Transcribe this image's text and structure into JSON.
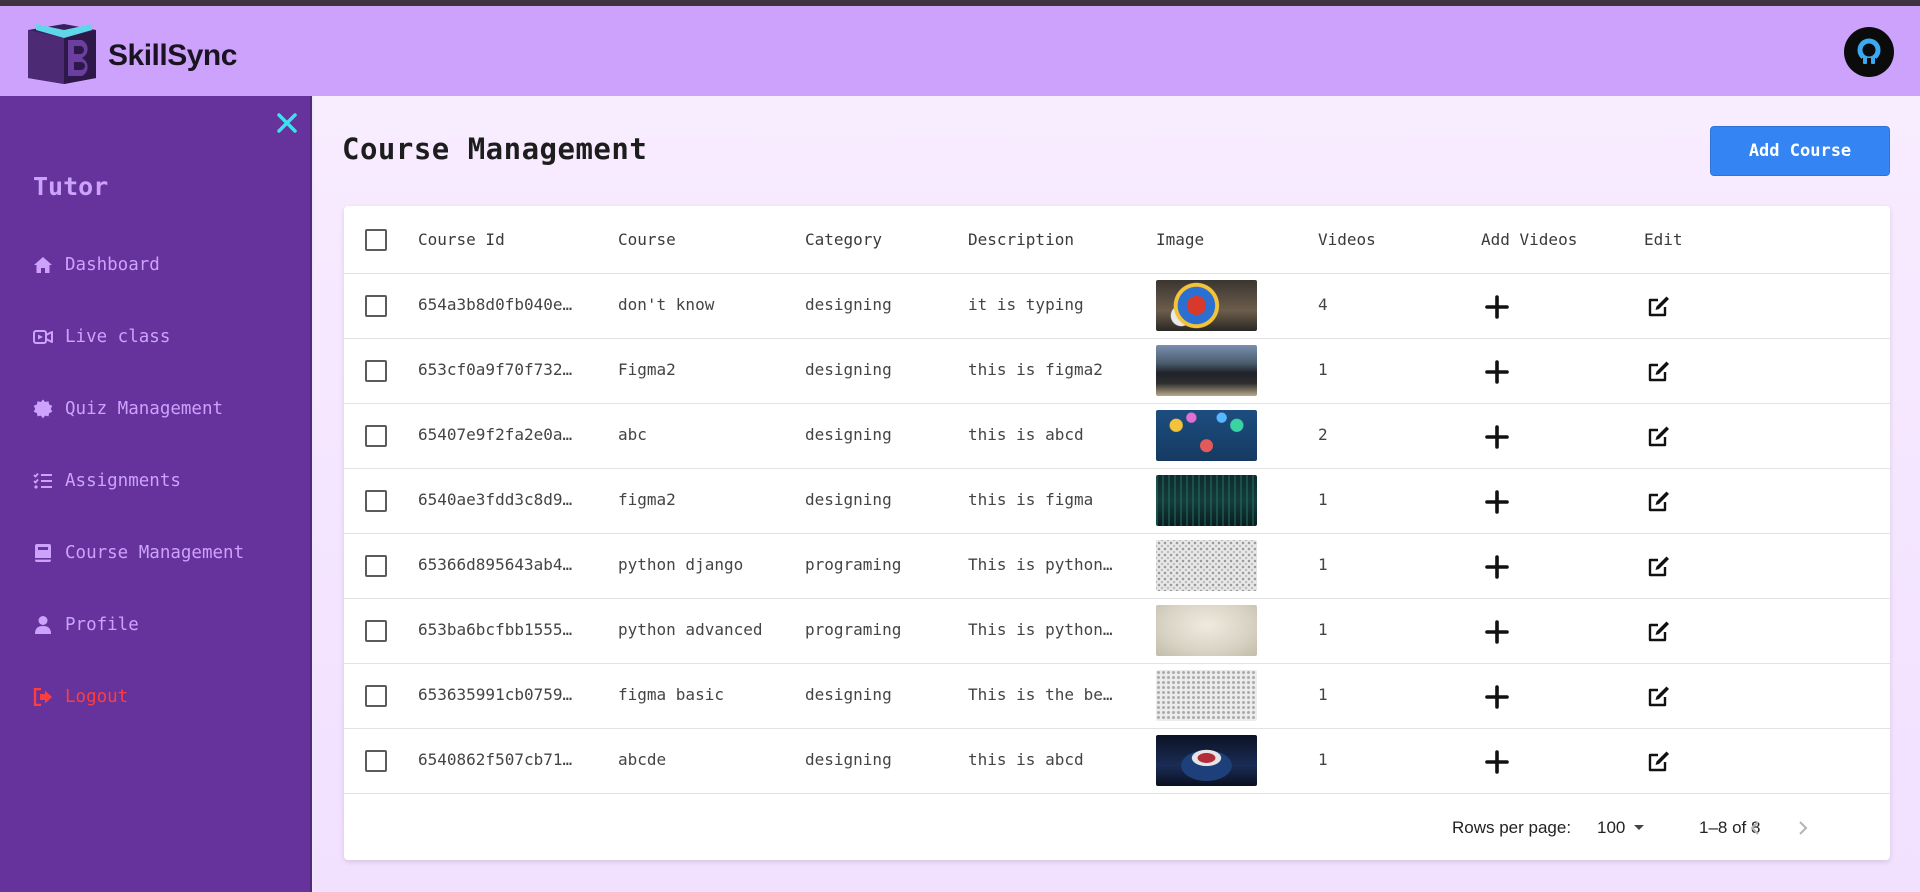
{
  "app": {
    "brand": "SkillSync"
  },
  "sidebar": {
    "role": "Tutor",
    "items": [
      {
        "label": "Dashboard",
        "icon": "home-icon"
      },
      {
        "label": "Live class",
        "icon": "video-icon"
      },
      {
        "label": "Quiz Management",
        "icon": "badge-icon"
      },
      {
        "label": "Assignments",
        "icon": "list-check-icon"
      },
      {
        "label": "Course Management",
        "icon": "book-icon"
      },
      {
        "label": "Profile",
        "icon": "user-icon"
      },
      {
        "label": "Logout",
        "icon": "logout-icon"
      }
    ]
  },
  "main": {
    "title": "Course Management",
    "add_button": "Add Course"
  },
  "table": {
    "headers": {
      "course_id": "Course Id",
      "course": "Course",
      "category": "Category",
      "description": "Description",
      "image": "Image",
      "videos": "Videos",
      "add_videos": "Add Videos",
      "edit": "Edit"
    },
    "rows": [
      {
        "id": "654a3b8d0fb040e…",
        "course": "don't know",
        "category": "designing",
        "description": "it is typing",
        "videos": "4",
        "image": "colorful-parrot-photo"
      },
      {
        "id": "653cf0a9f70f732…",
        "course": "Figma2",
        "category": "designing",
        "description": "this is figma2",
        "videos": "1",
        "image": "graduation-group-photo"
      },
      {
        "id": "65407e9f2fa2e0a…",
        "course": "abc",
        "category": "designing",
        "description": "this is abcd",
        "videos": "2",
        "image": "tech-icons-illustration"
      },
      {
        "id": "6540ae3fdd3c8d9…",
        "course": "figma2",
        "category": "designing",
        "description": "this is figma",
        "videos": "1",
        "image": "dark-code-matrix"
      },
      {
        "id": "65366d895643ab4…",
        "course": "python django",
        "category": "programing",
        "description": "This is python…",
        "videos": "1",
        "image": "grey-doodle-pattern"
      },
      {
        "id": "653ba6bcfbb1555…",
        "course": "python advanced",
        "category": "programing",
        "description": "This is python…",
        "videos": "1",
        "image": "beige-texture"
      },
      {
        "id": "653635991cb0759…",
        "course": "figma basic",
        "category": "designing",
        "description": "This is the be…",
        "videos": "1",
        "image": "grey-dot-pattern"
      },
      {
        "id": "6540862f507cb71…",
        "course": "abcde",
        "category": "designing",
        "description": "this is abcd",
        "videos": "1",
        "image": "dark-figure-poster"
      }
    ]
  },
  "pagination": {
    "rows_per_page_label": "Rows per page:",
    "rows_per_page": "100",
    "range": "1–8 of 8"
  },
  "colors": {
    "header": "#cda2fd",
    "sidebar": "#65339b",
    "accent_button": "#3584f3",
    "logout": "#ff3d3d",
    "close_icon": "#3fe0ee"
  }
}
